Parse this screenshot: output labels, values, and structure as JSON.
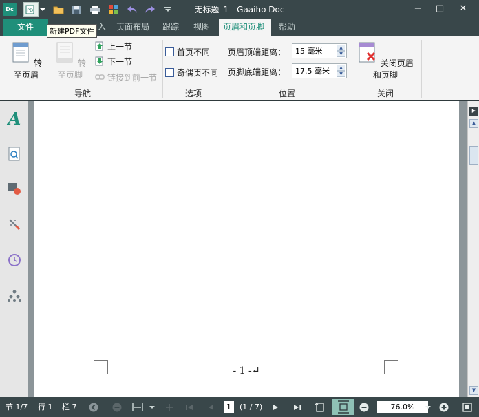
{
  "app": {
    "logo": "Dc",
    "title": "无标题_1 - Gaaiho Doc",
    "tooltip": "新建PDF文件"
  },
  "quick_access": [
    "new-pdf-icon",
    "open-folder-icon",
    "save-icon",
    "print-icon",
    "toolbox-icon",
    "undo-icon",
    "redo-icon",
    "customize-icon"
  ],
  "window_controls": {
    "minimize": "−",
    "maximize": "□",
    "close": "✕"
  },
  "tabs": {
    "file": "文件",
    "insert_partial": "入",
    "page_layout": "页面布局",
    "track": "跟踪",
    "view": "视图",
    "header_footer": "页眉和页脚",
    "help": "帮助"
  },
  "ribbon": {
    "navigation": {
      "goto_header": "转至页眉",
      "goto_footer": "转至页脚",
      "prev_section": "上一节",
      "next_section": "下一节",
      "link_previous": "链接到前一节",
      "label": "导航"
    },
    "options": {
      "different_first": "首页不同",
      "different_odd_even": "奇偶页不同",
      "label": "选项"
    },
    "position": {
      "header_top_label": "页眉顶端距离：",
      "header_top_value": "15 毫米",
      "footer_bottom_label": "页脚底端距离：",
      "footer_bottom_value": "17.5 毫米",
      "label": "位置"
    },
    "close": {
      "close_header_footer": "关闭页眉和页脚",
      "label": "关闭"
    }
  },
  "document": {
    "page_number_text": "- 1 -↵"
  },
  "status": {
    "section": "节 1/7",
    "line": "行 1",
    "column": "栏 7",
    "page_input": "1",
    "page_count": "(1 / 7)",
    "zoom": "76.0%"
  },
  "colors": {
    "accent": "#1f8f7a",
    "chrome": "#39474a",
    "ribbon": "#f4f4f4"
  }
}
